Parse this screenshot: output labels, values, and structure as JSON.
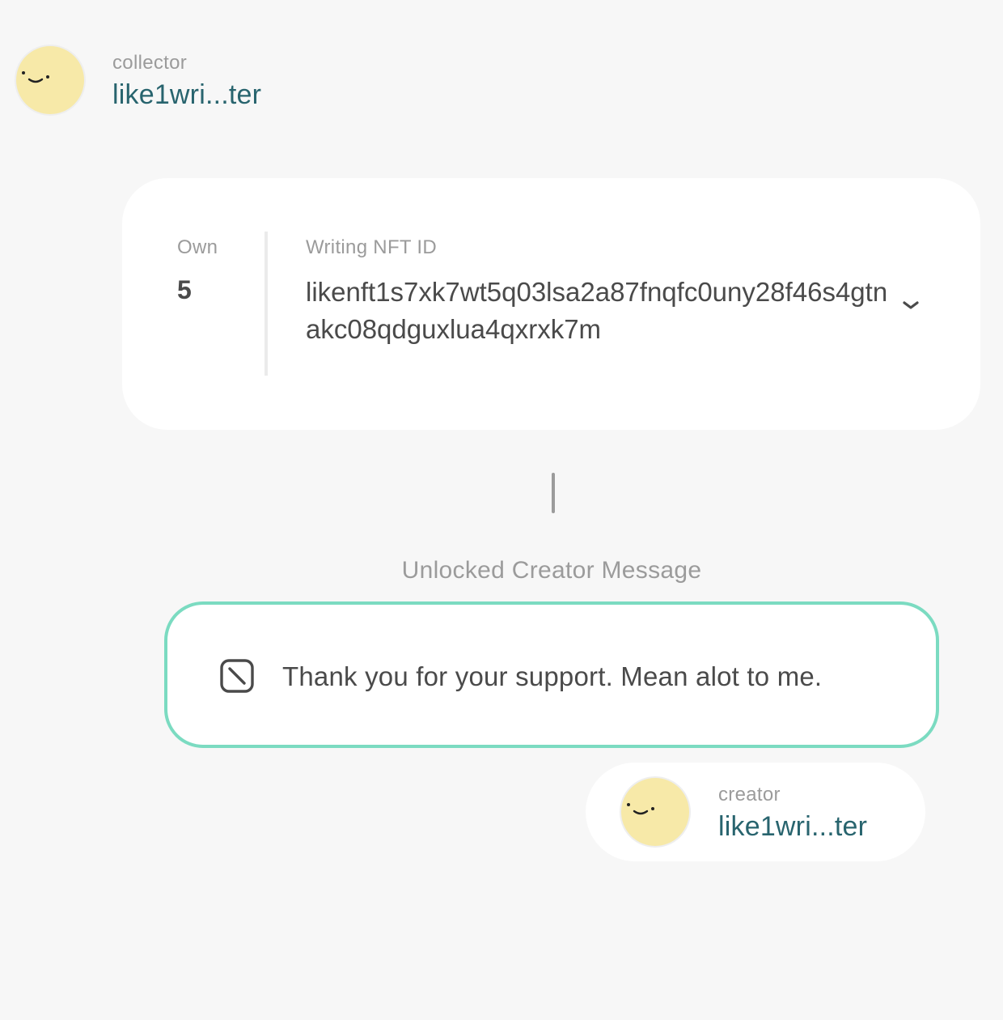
{
  "collector": {
    "role": "collector",
    "name": "like1wri...ter",
    "avatar_icon": "smiley-face-icon"
  },
  "nft_card": {
    "own_label": "Own",
    "own_value": "5",
    "nft_id_label": "Writing NFT ID",
    "nft_id_value": "likenft1s7xk7wt5q03lsa2a87fnqfc0uny28f46s4gtnakc08qdguxlua4qxrxk7m",
    "expand_icon": "chevron-down-icon"
  },
  "message": {
    "title": "Unlocked Creator Message",
    "text": "Thank you for your support. Mean alot to me.",
    "icon": "no-sign-icon"
  },
  "creator": {
    "role": "creator",
    "name": "like1wri...ter",
    "avatar_icon": "smiley-face-icon"
  },
  "colors": {
    "background": "#f7f7f7",
    "card": "#ffffff",
    "accent_border": "#7bdbc1",
    "name_text": "#28646e",
    "muted_text": "#9b9b9b",
    "body_text": "#4a4a4a",
    "avatar_fill": "#f7e9a8"
  }
}
